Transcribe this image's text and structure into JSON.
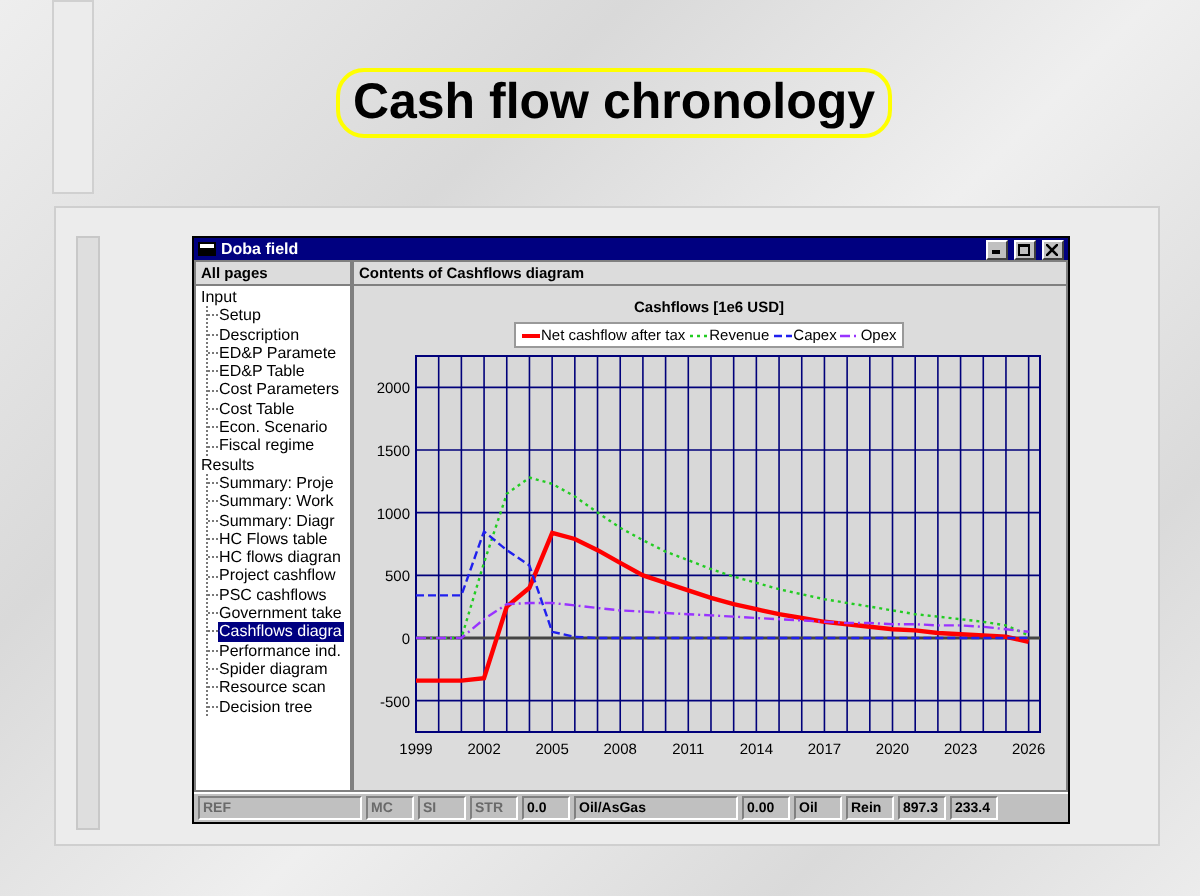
{
  "slide": {
    "title": "Cash flow chronology"
  },
  "window": {
    "title": "Doba field"
  },
  "sidebar": {
    "header": "All pages",
    "tree": [
      {
        "label": "Input",
        "selected": false,
        "children": [
          {
            "label": "Setup",
            "selected": false
          },
          {
            "label": "Description",
            "selected": false
          },
          {
            "label": "ED&P Paramete",
            "selected": false
          },
          {
            "label": "ED&P Table",
            "selected": false
          },
          {
            "label": "Cost Parameters",
            "selected": false
          },
          {
            "label": "Cost Table",
            "selected": false
          },
          {
            "label": "Econ. Scenario",
            "selected": false
          },
          {
            "label": "Fiscal regime",
            "selected": false
          }
        ]
      },
      {
        "label": "Results",
        "selected": false,
        "children": [
          {
            "label": "Summary: Proje",
            "selected": false
          },
          {
            "label": "Summary: Work",
            "selected": false
          },
          {
            "label": "Summary: Diagr",
            "selected": false
          },
          {
            "label": "HC Flows table",
            "selected": false
          },
          {
            "label": "HC flows diagran",
            "selected": false
          },
          {
            "label": "Project cashflow",
            "selected": false
          },
          {
            "label": "PSC cashflows",
            "selected": false
          },
          {
            "label": "Government take",
            "selected": false
          },
          {
            "label": "Cashflows diagra",
            "selected": true
          },
          {
            "label": "Performance ind.",
            "selected": false
          },
          {
            "label": "Spider diagram",
            "selected": false
          },
          {
            "label": "Resource scan",
            "selected": false
          },
          {
            "label": "Decision tree",
            "selected": false
          }
        ]
      }
    ]
  },
  "content": {
    "header": "Contents of Cashflows diagram",
    "chart_data": {
      "type": "line",
      "title": "Cashflows  [1e6 USD]",
      "x": [
        1999,
        2000,
        2001,
        2002,
        2003,
        2004,
        2005,
        2006,
        2007,
        2008,
        2009,
        2010,
        2011,
        2012,
        2013,
        2014,
        2015,
        2016,
        2017,
        2018,
        2019,
        2020,
        2021,
        2022,
        2023,
        2024,
        2025,
        2026
      ],
      "series": [
        {
          "name": "Net cashflow after tax",
          "color": "#ff0000",
          "line_style": "solid",
          "values": [
            -340,
            -340,
            -340,
            -320,
            250,
            400,
            840,
            790,
            700,
            600,
            500,
            440,
            380,
            320,
            270,
            230,
            190,
            160,
            130,
            110,
            90,
            70,
            60,
            40,
            30,
            20,
            10,
            -30
          ]
        },
        {
          "name": "Revenue",
          "color": "#22cc22",
          "line_style": "dotted",
          "values": [
            0,
            0,
            0,
            600,
            1150,
            1280,
            1230,
            1130,
            1000,
            880,
            780,
            690,
            620,
            550,
            490,
            440,
            390,
            350,
            310,
            280,
            250,
            220,
            190,
            170,
            150,
            130,
            100,
            20
          ]
        },
        {
          "name": "Capex",
          "color": "#2020ee",
          "line_style": "dashed",
          "values": [
            340,
            340,
            340,
            850,
            700,
            580,
            50,
            10,
            0,
            0,
            0,
            0,
            0,
            0,
            0,
            0,
            0,
            0,
            0,
            0,
            0,
            0,
            0,
            0,
            0,
            0,
            0,
            0
          ]
        },
        {
          "name": "Opex",
          "color": "#9933ff",
          "line_style": "dashdot",
          "values": [
            0,
            0,
            0,
            150,
            270,
            280,
            280,
            260,
            240,
            220,
            210,
            200,
            190,
            180,
            170,
            160,
            150,
            140,
            130,
            120,
            120,
            110,
            110,
            100,
            100,
            90,
            70,
            50
          ]
        }
      ],
      "grid": true,
      "xlim": [
        1999,
        2026.5
      ],
      "ylim": [
        -750,
        2250
      ],
      "xticks": [
        1999,
        2002,
        2005,
        2008,
        2011,
        2014,
        2017,
        2020,
        2023,
        2026
      ],
      "yticks": [
        -500,
        0,
        500,
        1000,
        1500,
        2000
      ]
    }
  },
  "status_bar": [
    {
      "text": "REF",
      "disabled": true,
      "kind": "wide"
    },
    {
      "text": "MC",
      "disabled": true,
      "kind": "narrow"
    },
    {
      "text": "SI",
      "disabled": true,
      "kind": "narrow"
    },
    {
      "text": "STR",
      "disabled": true,
      "kind": "narrow"
    },
    {
      "text": "0.0",
      "disabled": false,
      "kind": "narrow"
    },
    {
      "text": "Oil/AsGas",
      "disabled": false,
      "kind": "wide"
    },
    {
      "text": "0.00",
      "disabled": false,
      "kind": "narrow"
    },
    {
      "text": "Oil",
      "disabled": false,
      "kind": "narrow"
    },
    {
      "text": "Rein",
      "disabled": false,
      "kind": "narrow"
    },
    {
      "text": "897.3",
      "disabled": false,
      "kind": "narrow"
    },
    {
      "text": "233.4",
      "disabled": false,
      "kind": "narrow"
    }
  ]
}
